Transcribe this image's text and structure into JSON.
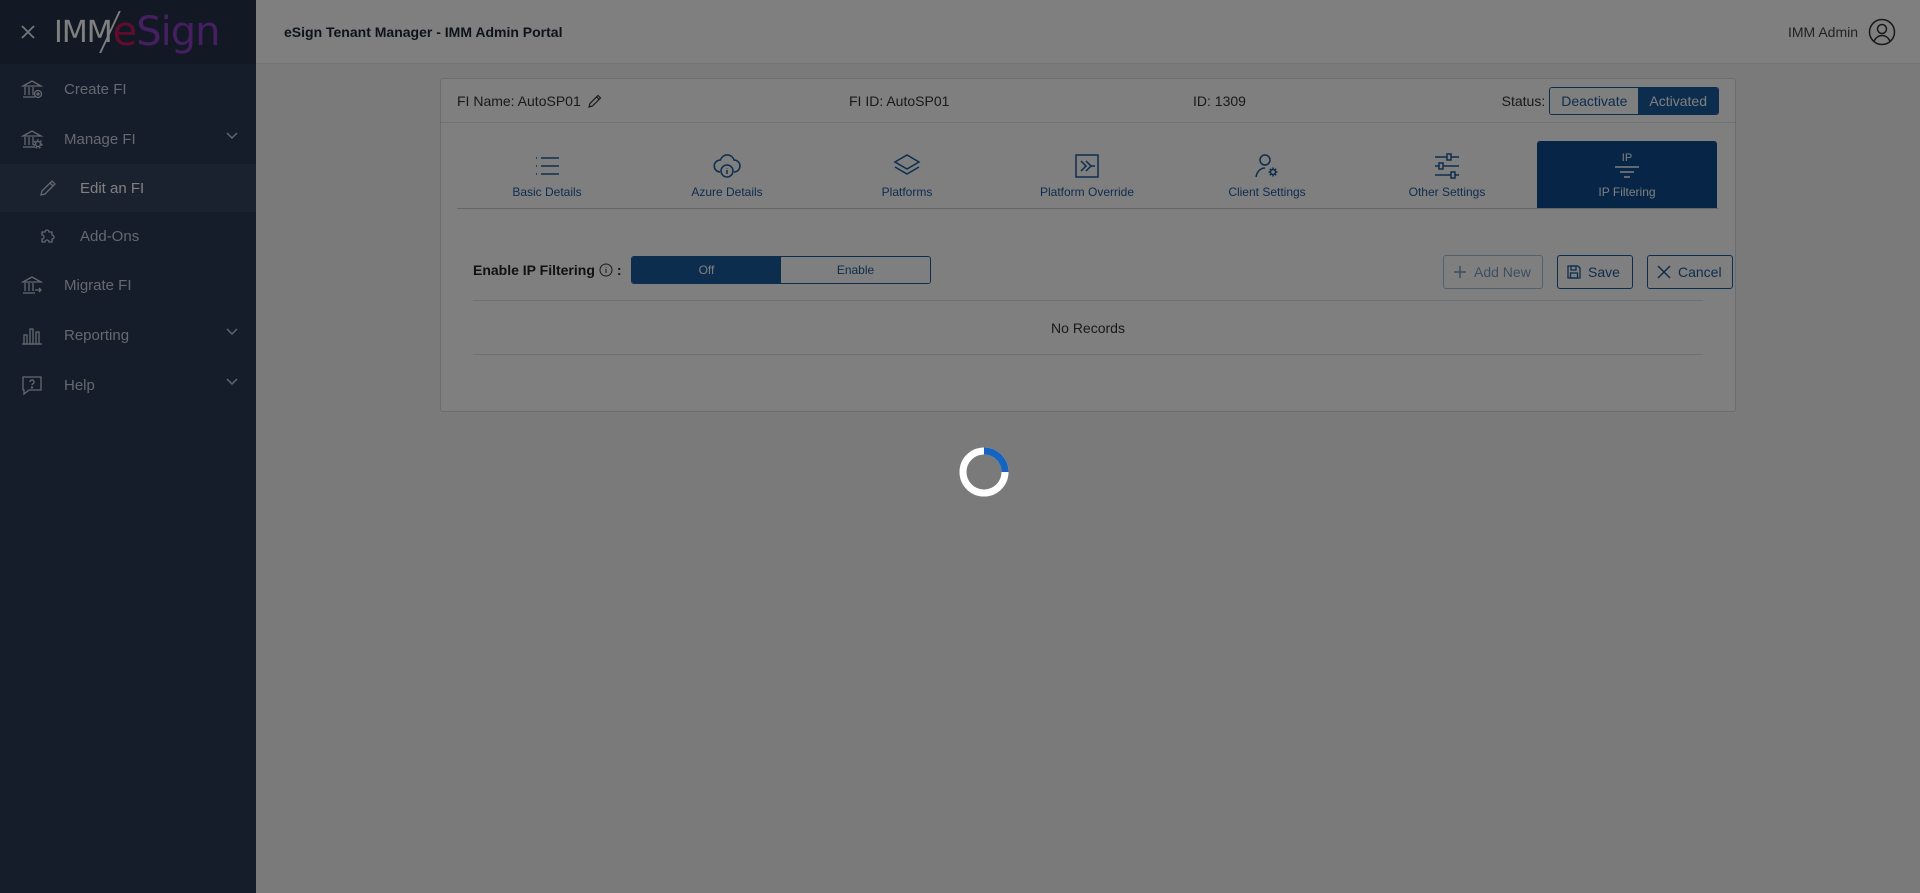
{
  "sidebar": {
    "logo": {
      "part1": "IMM",
      "part2_a": "e",
      "part2_b": "Sign"
    },
    "items": [
      {
        "label": "Create FI",
        "icon": "bank-add-icon"
      },
      {
        "label": "Manage FI",
        "icon": "bank-settings-icon",
        "expanded": true
      },
      {
        "label": "Edit an FI",
        "icon": "pencil-icon",
        "sub": true,
        "active": true
      },
      {
        "label": "Add-Ons",
        "icon": "puzzle-icon",
        "sub": true
      },
      {
        "label": "Migrate FI",
        "icon": "bank-migrate-icon"
      },
      {
        "label": "Reporting",
        "icon": "bar-chart-icon"
      },
      {
        "label": "Help",
        "icon": "help-icon"
      }
    ]
  },
  "header": {
    "title": "eSign Tenant Manager - IMM Admin Portal",
    "user": "IMM Admin"
  },
  "fi": {
    "name_label": "FI Name: AutoSP01",
    "fi_id_label": "FI ID: AutoSP01",
    "id_label": "ID: 1309",
    "status_label": "Status:",
    "deactivate": "Deactivate",
    "activated": "Activated"
  },
  "tabs": [
    {
      "label": "Basic Details",
      "icon": "list-icon"
    },
    {
      "label": "Azure Details",
      "icon": "cloud-info-icon"
    },
    {
      "label": "Platforms",
      "icon": "layers-icon"
    },
    {
      "label": "Platform Override",
      "icon": "override-icon"
    },
    {
      "label": "Client Settings",
      "icon": "user-settings-icon"
    },
    {
      "label": "Other Settings",
      "icon": "sliders-icon"
    },
    {
      "label": "IP Filtering",
      "top": "IP",
      "icon": "filter-icon",
      "active": true
    }
  ],
  "ip": {
    "label": "Enable IP Filtering",
    "colon": ":",
    "off": "Off",
    "enable": "Enable",
    "add_new": "Add New",
    "save": "Save",
    "cancel": "Cancel",
    "no_records": "No Records"
  },
  "colors": {
    "sidebar_bg": "#2b3a55",
    "accent": "#1a5a9c",
    "active_tab": "#0e4a8c"
  }
}
